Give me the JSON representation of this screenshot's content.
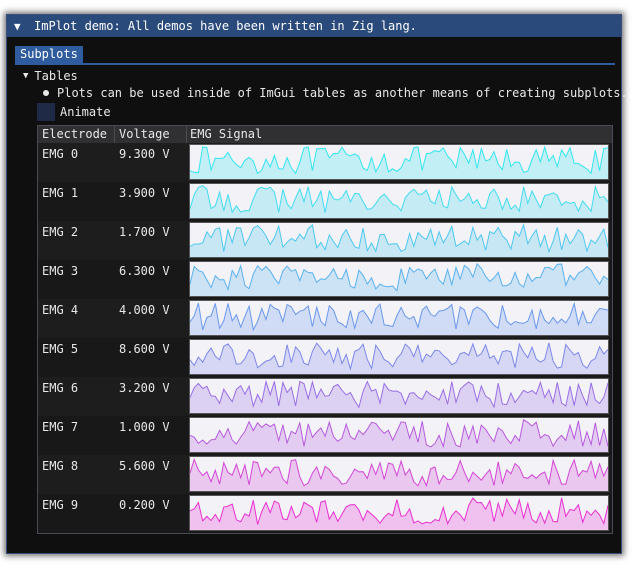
{
  "window": {
    "title": "ImPlot demo: All demos have been written in Zig lang.",
    "collapse_icon": "triangle-down-icon",
    "tab": "Subplots"
  },
  "section": {
    "label": "Tables",
    "note": "Plots can be used inside of ImGui tables as another means of creating subplots.",
    "animate_label": "Animate",
    "animate_checked": false
  },
  "table": {
    "headers": [
      "Electrode",
      "Voltage",
      "EMG Signal"
    ],
    "rows": [
      {
        "name": "EMG 0",
        "voltage": "9.300 V",
        "color": "#33e6f0"
      },
      {
        "name": "EMG 1",
        "voltage": "3.900 V",
        "color": "#41dcef"
      },
      {
        "name": "EMG 2",
        "voltage": "1.700 V",
        "color": "#4dc8ef"
      },
      {
        "name": "EMG 3",
        "voltage": "6.300 V",
        "color": "#5ab2ef"
      },
      {
        "name": "EMG 4",
        "voltage": "4.000 V",
        "color": "#6a98ee"
      },
      {
        "name": "EMG 5",
        "voltage": "8.600 V",
        "color": "#7e88ec"
      },
      {
        "name": "EMG 6",
        "voltage": "3.200 V",
        "color": "#9a6ee6"
      },
      {
        "name": "EMG 7",
        "voltage": "1.000 V",
        "color": "#b85adf"
      },
      {
        "name": "EMG 8",
        "voltage": "5.600 V",
        "color": "#d446d8"
      },
      {
        "name": "EMG 9",
        "voltage": "0.200 V",
        "color": "#ea2ed2"
      }
    ]
  },
  "chart_data": {
    "type": "area",
    "title": "",
    "series_count": 10,
    "ylim": [
      0,
      1
    ],
    "points_per_series": 100
  }
}
